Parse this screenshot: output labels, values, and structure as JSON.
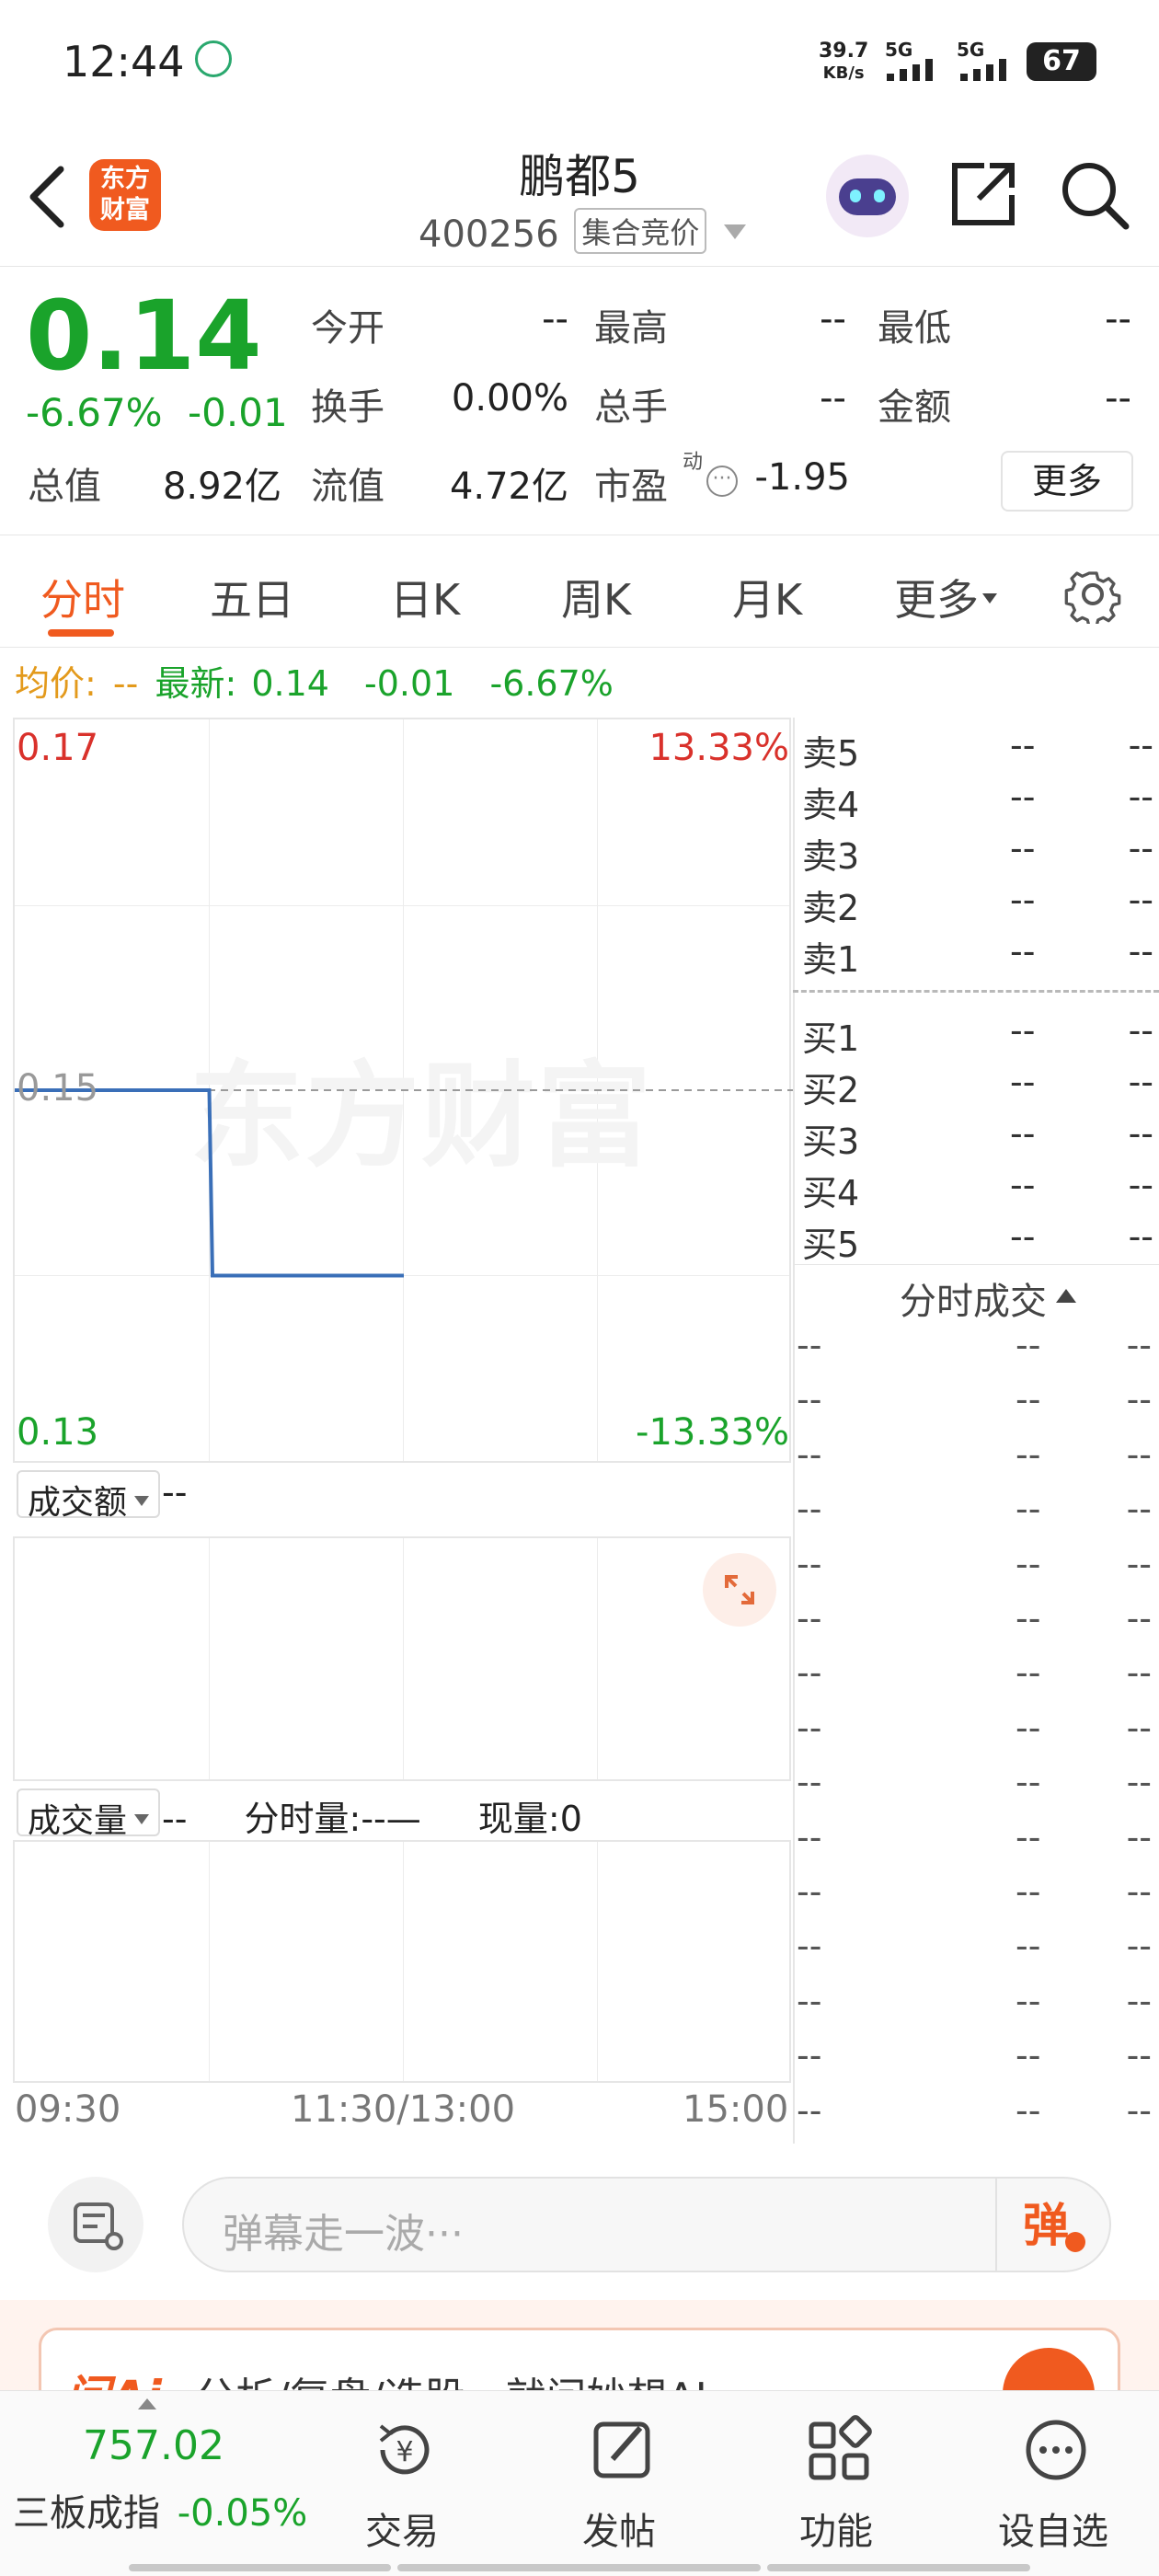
{
  "status_bar": {
    "time": "12:44",
    "net_speed_value": "39.7",
    "net_speed_unit": "KB/s",
    "sig1_label": "5G",
    "sig2_label": "5G",
    "battery": "67"
  },
  "header": {
    "logo_line1": "东方",
    "logo_line2": "财富",
    "stock_name": "鹏都5",
    "stock_code": "400256",
    "auction_tag": "集合竞价"
  },
  "quote": {
    "price": "0.14",
    "change_pct": "-6.67%",
    "change": "-0.01",
    "open_label": "今开",
    "open_value": "--",
    "high_label": "最高",
    "high_value": "--",
    "low_label": "最低",
    "low_value": "--",
    "turnover_label": "换手",
    "turnover_value": "0.00%",
    "volume_label": "总手",
    "volume_value": "--",
    "amount_label": "金额",
    "amount_value": "--",
    "mcap_label": "总值",
    "mcap_value": "8.92亿",
    "float_label": "流值",
    "float_value": "4.72亿",
    "pe_label": "市盈",
    "pe_sup": "动",
    "pe_value": "-1.95",
    "more_label": "更多"
  },
  "tabs": [
    "分时",
    "五日",
    "日K",
    "周K",
    "月K",
    "更多"
  ],
  "info_line": {
    "avg_label": "均价:",
    "avg_value": "--",
    "latest_label": "最新:",
    "latest_value": "0.14",
    "latest_change": "-0.01",
    "latest_pct": "-6.67%"
  },
  "chart_data": {
    "type": "line",
    "title": "",
    "x": [
      "09:30",
      "10:30",
      "10:31",
      "11:30"
    ],
    "series": [
      {
        "values": [
          0.15,
          0.15,
          0.14,
          0.14
        ]
      }
    ],
    "ylim": [
      0.13,
      0.17
    ],
    "prev_close": 0.15,
    "y_labels": {
      "top": "0.17",
      "mid": "0.15",
      "bottom": "0.13"
    },
    "pct_labels": {
      "top": "13.33%",
      "bottom": "-13.33%"
    },
    "x_labels": [
      "09:30",
      "11:30/13:00",
      "15:00"
    ],
    "line_color": "#3a6fb8",
    "watermark": "东方财富"
  },
  "sub_charts": {
    "amount_selector": "成交额",
    "amount_value": "--",
    "volume_selector": "成交量",
    "volume_value": "--",
    "minute_vol_label": "分时量:",
    "minute_vol_value": "--—",
    "current_vol_label": "现量:",
    "current_vol_value": "0"
  },
  "order_book": {
    "asks": [
      {
        "label": "卖5",
        "price": "--",
        "vol": "--"
      },
      {
        "label": "卖4",
        "price": "--",
        "vol": "--"
      },
      {
        "label": "卖3",
        "price": "--",
        "vol": "--"
      },
      {
        "label": "卖2",
        "price": "--",
        "vol": "--"
      },
      {
        "label": "卖1",
        "price": "--",
        "vol": "--"
      }
    ],
    "bids": [
      {
        "label": "买1",
        "price": "--",
        "vol": "--"
      },
      {
        "label": "买2",
        "price": "--",
        "vol": "--"
      },
      {
        "label": "买3",
        "price": "--",
        "vol": "--"
      },
      {
        "label": "买4",
        "price": "--",
        "vol": "--"
      },
      {
        "label": "买5",
        "price": "--",
        "vol": "--"
      }
    ],
    "trades_title": "分时成交",
    "trade_rows": 15,
    "trade_placeholder": "--"
  },
  "input_bar": {
    "placeholder": "弹幕走一波···",
    "danmu_label": "弹"
  },
  "promo": {
    "brand": "问Ai",
    "text": "分析/复盘/选股，就问妙想AI"
  },
  "tab_bar": {
    "index_value": "757.02",
    "index_name": "三板成指",
    "index_change": "-0.05%",
    "items": [
      "交易",
      "发帖",
      "功能",
      "设自选"
    ]
  }
}
